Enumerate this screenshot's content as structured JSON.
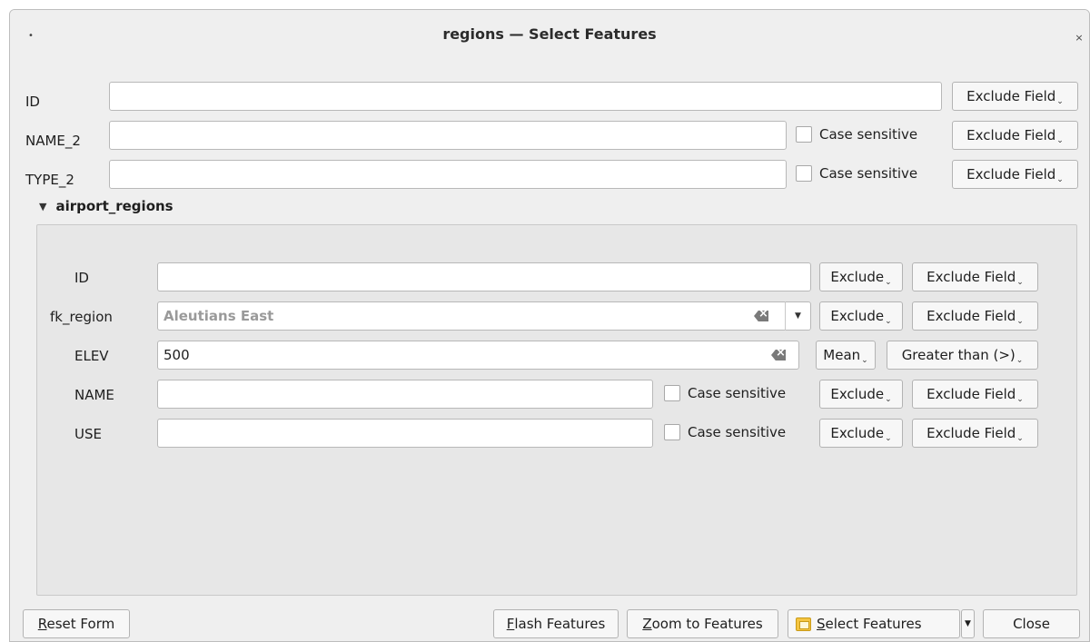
{
  "window": {
    "title": "regions — Select Features",
    "app_icon": "qgis-app-icon",
    "close_glyph": "×"
  },
  "top_fields": [
    {
      "label": "ID",
      "value": "",
      "has_case": false,
      "button": "Exclude Field"
    },
    {
      "label": "NAME_2",
      "value": "",
      "has_case": true,
      "button": "Exclude Field"
    },
    {
      "label": "TYPE_2",
      "value": "",
      "has_case": true,
      "button": "Exclude Field"
    }
  ],
  "case_sensitive_label": "Case sensitive",
  "section": {
    "title": "airport_regions",
    "expanded": true,
    "fields": {
      "id": {
        "label": "ID",
        "value": "",
        "op1": "Exclude",
        "op2": "Exclude Field"
      },
      "fk_region": {
        "label": "fk_region",
        "value": "Aleutians East",
        "op1": "Exclude",
        "op2": "Exclude Field"
      },
      "elev": {
        "label": "ELEV",
        "value": "500",
        "op1": "Mean",
        "op2": "Greater than (>)"
      },
      "name": {
        "label": "NAME",
        "value": "",
        "op1": "Exclude",
        "op2": "Exclude Field"
      },
      "use": {
        "label": "USE",
        "value": "",
        "op1": "Exclude",
        "op2": "Exclude Field"
      }
    }
  },
  "footer": {
    "reset_pre": "",
    "reset_u": "R",
    "reset_post": "eset Form",
    "flash_pre": "",
    "flash_u": "F",
    "flash_post": "lash Features",
    "zoom_pre": "",
    "zoom_u": "Z",
    "zoom_post": "oom to Features",
    "select_pre": "",
    "select_u": "S",
    "select_post": "elect Features",
    "close": "Close"
  }
}
